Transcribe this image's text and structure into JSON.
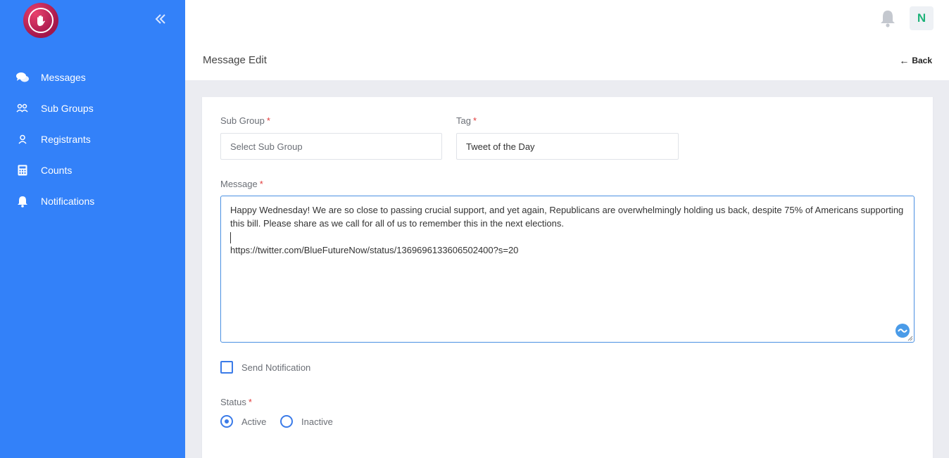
{
  "colors": {
    "sidebar": "#3381f9",
    "accent": "#3b7be8",
    "required": "#e23b3b",
    "avatar_text": "#1fb37a"
  },
  "sidebar": {
    "logo_icon": "hand-heart-logo",
    "collapse_icon": "double-chevron-left-icon",
    "items": [
      {
        "label": "Messages",
        "icon": "chat-bubbles-icon"
      },
      {
        "label": "Sub Groups",
        "icon": "users-icon"
      },
      {
        "label": "Registrants",
        "icon": "user-icon"
      },
      {
        "label": "Counts",
        "icon": "calculator-icon"
      },
      {
        "label": "Notifications",
        "icon": "bell-icon"
      }
    ]
  },
  "topbar": {
    "avatar_initial": "N",
    "bell_icon": "bell-icon"
  },
  "page": {
    "title": "Message Edit",
    "back_label": "Back"
  },
  "form": {
    "sub_group": {
      "label": "Sub Group",
      "required_mark": "*",
      "placeholder": "Select Sub Group",
      "value": ""
    },
    "tag": {
      "label": "Tag",
      "required_mark": "*",
      "value": "Tweet of the Day"
    },
    "message": {
      "label": "Message",
      "required_mark": "*",
      "line1": "Happy Wednesday! We are so close to passing crucial support, and yet again, Republicans are overwhelmingly holding us back, despite 75% of Americans supporting this bill. Please share as we call for all of us to remember this in the next elections.",
      "line3": "https://twitter.com/BlueFutureNow/status/1369696133606502400?s=20"
    },
    "send_notification": {
      "label": "Send Notification",
      "checked": false
    },
    "status": {
      "label": "Status",
      "required_mark": "*",
      "options": [
        {
          "label": "Active",
          "selected": true
        },
        {
          "label": "Inactive",
          "selected": false
        }
      ]
    }
  }
}
